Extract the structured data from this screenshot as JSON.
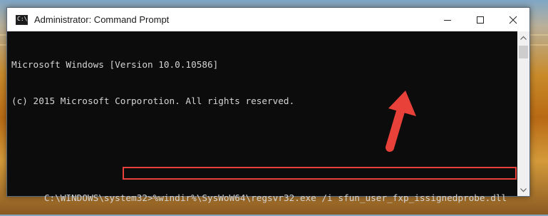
{
  "window": {
    "title": "Administrator: Command Prompt",
    "app_icon_text": "C:\\."
  },
  "console": {
    "lines": [
      "Microsoft Windows [Version 10.0.10586]",
      "(c) 2015 Microsoft Corporotion. All rights reserved."
    ],
    "prompt": "C:\\WINDOWS\\system32>",
    "command": "%windir%\\SysWoW64\\regsvr32.exe /i sfun_user_fxp_issignedprobe.dll"
  },
  "colors": {
    "highlight": "#e8413a",
    "console_bg": "#0c0c0c",
    "console_text": "#d4d4d4"
  },
  "icons": [
    "minimize-icon",
    "maximize-icon",
    "close-icon",
    "scroll-up-icon",
    "scroll-down-icon",
    "red-arrow-pointer"
  ]
}
